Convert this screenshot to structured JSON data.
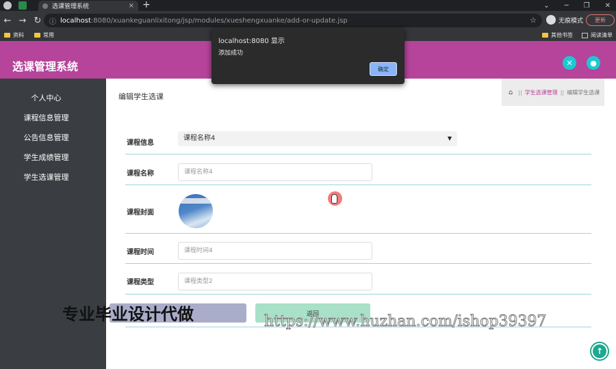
{
  "browser": {
    "tab_title": "选课管理系统",
    "new_tab_symbol": "+",
    "close_symbol": "×",
    "url_host": "localhost",
    "url_rest": ":8080/xuankeguanlixitong/jsp/modules/xueshengxuanke/add-or-update.jsp",
    "incognito_label": "无痕模式",
    "update_label": "更新",
    "bookmarks": [
      {
        "label": "资料"
      },
      {
        "label": "常用"
      }
    ],
    "other_bookmarks": "其他书签",
    "reading_list": "阅读清单"
  },
  "app": {
    "title": "选课管理系统"
  },
  "sidebar": {
    "items": [
      {
        "label": "个人中心"
      },
      {
        "label": "课程信息管理"
      },
      {
        "label": "公告信息管理"
      },
      {
        "label": "学生成绩管理"
      },
      {
        "label": "学生选课管理"
      }
    ]
  },
  "main": {
    "page_title": "编辑学生选课",
    "breadcrumb": {
      "sep": "||",
      "level1": "学生选课管理",
      "level2": "编辑学生选课"
    },
    "form": {
      "course_info_label": "课程信息",
      "course_info_value": "课程名称4",
      "course_name_label": "课程名称",
      "course_name_value": "课程名称4",
      "course_cover_label": "课程封面",
      "course_time_label": "课程时间",
      "course_time_value": "课程时间4",
      "course_type_label": "课程类型",
      "course_type_value": "课程类型2",
      "back_button": "返回"
    }
  },
  "dialog": {
    "title": "localhost:8080 显示",
    "message": "添加成功",
    "ok_label": "确定"
  },
  "watermarks": {
    "left": "专业毕业设计代做",
    "right": "https://www.huzhan.com/ishop39397"
  },
  "colors": {
    "header": "#b5449a",
    "sidebar": "#3a3d42",
    "accent_teal": "#1ec8d2",
    "row_divider": "#9bd5dc"
  },
  "icons": {
    "header_left": "expand-icon",
    "header_right": "user-icon",
    "back_to_top": "arrow-up-icon"
  }
}
